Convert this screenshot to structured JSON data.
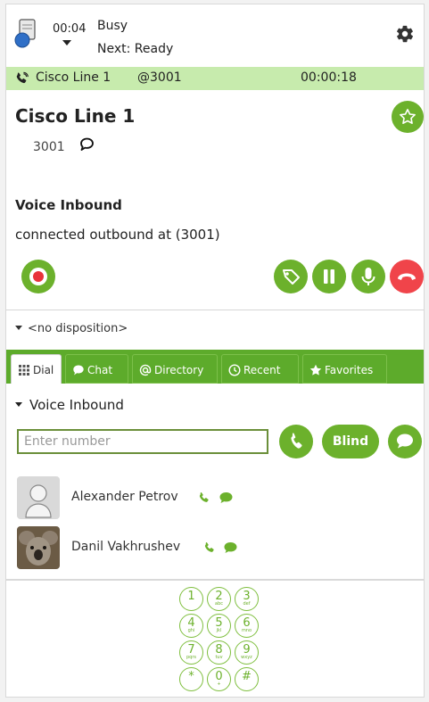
{
  "header": {
    "timer": "00:04",
    "status": "Busy",
    "next_status": "Next: Ready"
  },
  "call_bar": {
    "line_name": "Cisco Line 1",
    "extension": "@3001",
    "duration": "00:00:18"
  },
  "line": {
    "title": "Cisco Line 1",
    "number": "3001"
  },
  "interaction": {
    "title": "Voice Inbound",
    "detail": "connected outbound at (3001)"
  },
  "disposition": {
    "label": "<no disposition>"
  },
  "tabs": [
    {
      "label": "Dial",
      "icon": "keypad-icon"
    },
    {
      "label": "Chat",
      "icon": "chat-bubble-icon"
    },
    {
      "label": "Directory",
      "icon": "at-sign-icon"
    },
    {
      "label": "Recent",
      "icon": "clock-icon"
    },
    {
      "label": "Favorites",
      "icon": "star-icon"
    }
  ],
  "dial": {
    "section_title": "Voice Inbound",
    "input_placeholder": "Enter number",
    "blind_label": "Blind"
  },
  "contacts": [
    {
      "name": "Alexander Petrov"
    },
    {
      "name": "Danil Vakhrushev"
    }
  ],
  "keypad": [
    {
      "digit": "1",
      "letters": ""
    },
    {
      "digit": "2",
      "letters": "abc"
    },
    {
      "digit": "3",
      "letters": "def"
    },
    {
      "digit": "4",
      "letters": "ghi"
    },
    {
      "digit": "5",
      "letters": "jkl"
    },
    {
      "digit": "6",
      "letters": "mno"
    },
    {
      "digit": "7",
      "letters": "pqrs"
    },
    {
      "digit": "8",
      "letters": "tuv"
    },
    {
      "digit": "9",
      "letters": "wxyz"
    },
    {
      "digit": "*",
      "letters": ""
    },
    {
      "digit": "0",
      "letters": "+"
    },
    {
      "digit": "#",
      "letters": ""
    }
  ],
  "colors": {
    "accent_green": "#6cb12c",
    "tab_bar_green": "#5dab2b",
    "call_bar_green": "#c7ebad",
    "hangup_red": "#f0444a"
  }
}
